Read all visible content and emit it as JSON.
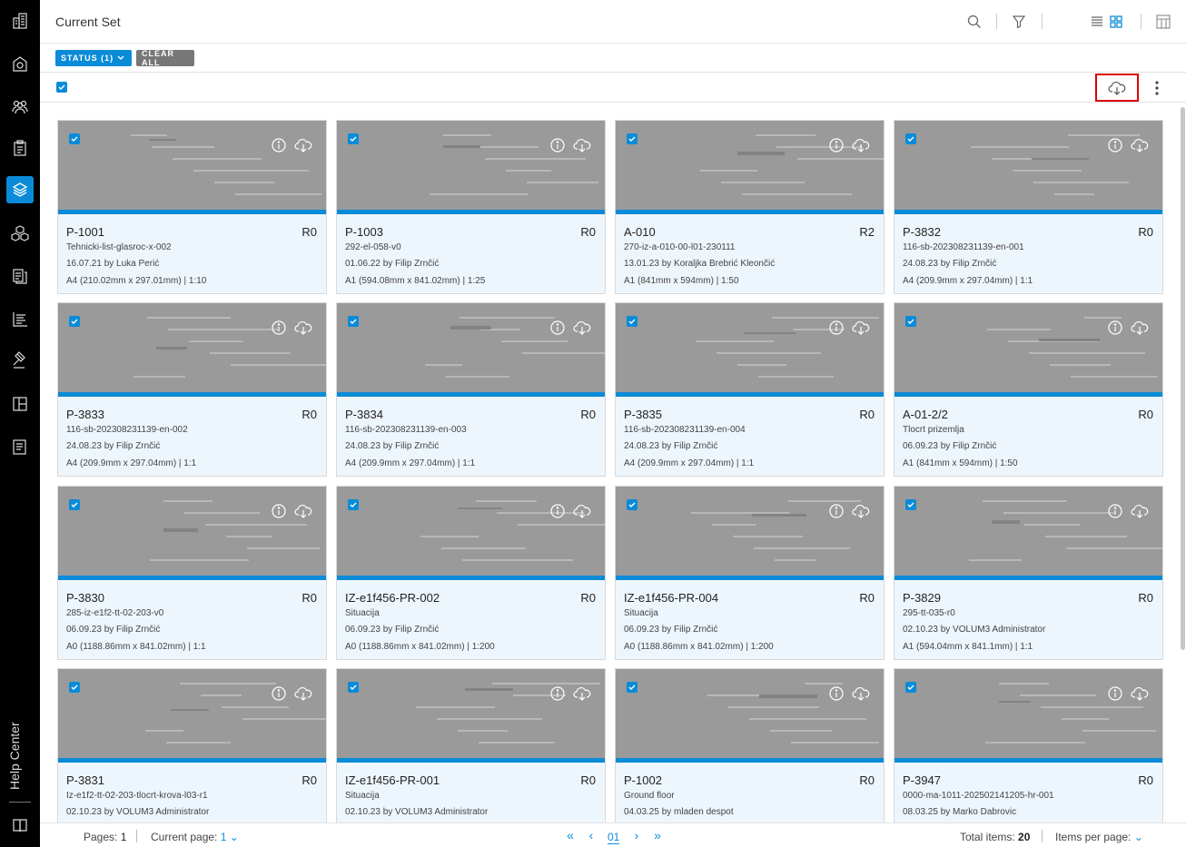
{
  "header": {
    "title": "Current Set"
  },
  "filters": {
    "status_label": "STATUS (1)",
    "clear_label": "CLEAR ALL"
  },
  "sidebar": {
    "items": [
      "building-icon",
      "settings-building-icon",
      "people-icon",
      "clipboard-icon",
      "layers-icon",
      "cubes-icon",
      "document-stack-icon",
      "tasks-icon",
      "gavel-icon",
      "layout-icon",
      "report-icon"
    ],
    "active": "layers-icon",
    "help_label": "Help Center"
  },
  "cards": [
    {
      "title": "P-1001",
      "rev": "R0",
      "sub": "Tehnicki-list-glasroc-x-002",
      "date": "16.07.21 by Luka Perić",
      "size": "A4 (210.02mm x 297.01mm) | 1:10"
    },
    {
      "title": "P-1003",
      "rev": "R0",
      "sub": "292-el-058-v0",
      "date": "01.06.22 by Filip Zrnčić",
      "size": "A1 (594.08mm x 841.02mm) | 1:25"
    },
    {
      "title": "A-010",
      "rev": "R2",
      "sub": "270-iz-a-010-00-l01-230111",
      "date": "13.01.23 by Koraljka Brebrić Kleončić",
      "size": "A1 (841mm x 594mm) | 1:50"
    },
    {
      "title": "P-3832",
      "rev": "R0",
      "sub": "116-sb-202308231139-en-001",
      "date": "24.08.23 by Filip Zrnčić",
      "size": "A4 (209.9mm x 297.04mm) | 1:1"
    },
    {
      "title": "P-3833",
      "rev": "R0",
      "sub": "116-sb-202308231139-en-002",
      "date": "24.08.23 by Filip Zrnčić",
      "size": "A4 (209.9mm x 297.04mm) | 1:1"
    },
    {
      "title": "P-3834",
      "rev": "R0",
      "sub": "116-sb-202308231139-en-003",
      "date": "24.08.23 by Filip Zrnčić",
      "size": "A4 (209.9mm x 297.04mm) | 1:1"
    },
    {
      "title": "P-3835",
      "rev": "R0",
      "sub": "116-sb-202308231139-en-004",
      "date": "24.08.23 by Filip Zrnčić",
      "size": "A4 (209.9mm x 297.04mm) | 1:1"
    },
    {
      "title": "A-01-2/2",
      "rev": "R0",
      "sub": "Tlocrt prizemlja",
      "date": "06.09.23 by Filip Zrnčić",
      "size": "A1 (841mm x 594mm) | 1:50"
    },
    {
      "title": "P-3830",
      "rev": "R0",
      "sub": "285-iz-e1f2-tt-02-203-v0",
      "date": "06.09.23 by Filip Zrnčić",
      "size": "A0 (1188.86mm x 841.02mm) | 1:1"
    },
    {
      "title": "IZ-e1f456-PR-002",
      "rev": "R0",
      "sub": "Situacija",
      "date": "06.09.23 by Filip Zrnčić",
      "size": "A0 (1188.86mm x 841.02mm) | 1:200"
    },
    {
      "title": "IZ-e1f456-PR-004",
      "rev": "R0",
      "sub": "Situacija",
      "date": "06.09.23 by Filip Zrnčić",
      "size": "A0 (1188.86mm x 841.02mm) | 1:200"
    },
    {
      "title": "P-3829",
      "rev": "R0",
      "sub": "295-tt-035-r0",
      "date": "02.10.23 by VOLUM3 Administrator",
      "size": "A1 (594.04mm x 841.1mm) | 1:1"
    },
    {
      "title": "P-3831",
      "rev": "R0",
      "sub": "Iz-e1f2-tt-02-203-tlocrt-krova-l03-r1",
      "date": "02.10.23 by VOLUM3 Administrator",
      "size": ""
    },
    {
      "title": "IZ-e1f456-PR-001",
      "rev": "R0",
      "sub": "Situacija",
      "date": "02.10.23 by VOLUM3 Administrator",
      "size": ""
    },
    {
      "title": "P-1002",
      "rev": "R0",
      "sub": "Ground floor",
      "date": "04.03.25 by mladen despot",
      "size": ""
    },
    {
      "title": "P-3947",
      "rev": "R0",
      "sub": "0000-ma-1011-202502141205-hr-001",
      "date": "08.03.25 by Marko Dabrovic",
      "size": ""
    }
  ],
  "footer": {
    "pages_label": "Pages:",
    "pages_value": "1",
    "current_label": "Current page:",
    "current_value": "1",
    "page_display": "01",
    "total_label": "Total items:",
    "total_value": "20",
    "per_page_label": "Items per page:"
  },
  "colors": {
    "accent": "#0a8bd8",
    "sidebar": "#000000",
    "highlight": "#dd0000",
    "card_bg": "#eef6fd"
  }
}
